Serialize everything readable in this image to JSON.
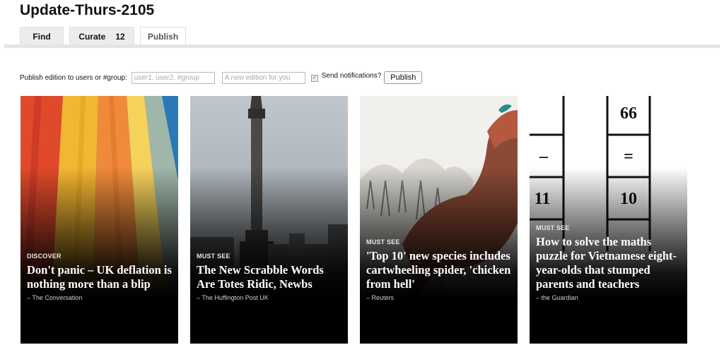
{
  "page": {
    "title": "Update-Thurs-2105"
  },
  "tabs": [
    {
      "label": "Find"
    },
    {
      "label": "Curate",
      "count": "12"
    },
    {
      "label": "Publish",
      "active": true
    }
  ],
  "publish_bar": {
    "label": "Publish edition to users or #group:",
    "users_placeholder": "user1, user2, #group",
    "users_value": "",
    "edition_placeholder": "A new edition for you",
    "edition_value": "",
    "notifications_checked": true,
    "notifications_label": "Send notifications?",
    "button_label": "Publish"
  },
  "cards": [
    {
      "category": "DISCOVER",
      "headline": "Don't panic – UK deflation is nothing more than a blip",
      "source": "– The Conversation",
      "image": "hot-air-balloon"
    },
    {
      "category": "MUST SEE",
      "headline": "The New Scrabble Words Are Totes Ridic, Newbs",
      "source": "– The Huffington Post UK",
      "image": "nelsons-column"
    },
    {
      "category": "MUST SEE",
      "headline": "'Top 10' new species includes cartwheeling spider, 'chicken from hell'",
      "source": "– Reuters",
      "image": "dinosaur-illustration"
    },
    {
      "category": "MUST SEE",
      "headline": "How to solve the maths puzzle for Vietnamese eight-year-olds that stumped parents and teachers",
      "source": "– the Guardian",
      "image": "maths-grid",
      "grid_cells": [
        "66",
        "–",
        "=",
        "11",
        "10"
      ]
    }
  ],
  "colors": {
    "tab_bg": "#ececec",
    "rule": "#e4e4e4",
    "card_bg": "#000000"
  }
}
